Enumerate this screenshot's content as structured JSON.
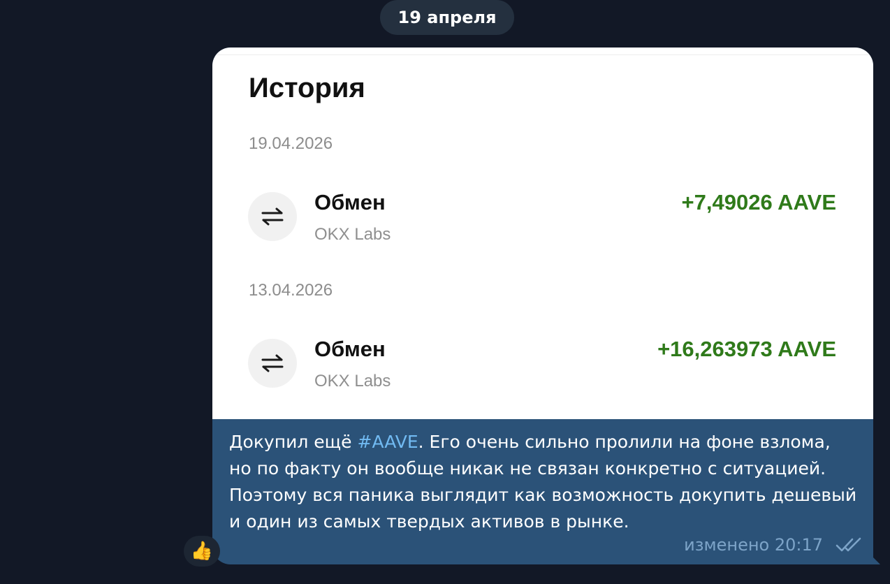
{
  "chat": {
    "date_separator": "19 апреля"
  },
  "message": {
    "screenshot": {
      "title": "История",
      "transactions": [
        {
          "date": "19.04.2026",
          "icon": "swap-arrows-icon",
          "title": "Обмен",
          "subtitle": "OKX Labs",
          "amount": "+7,49026 AAVE"
        },
        {
          "date": "13.04.2026",
          "icon": "swap-arrows-icon",
          "title": "Обмен",
          "subtitle": "OKX Labs",
          "amount": "+16,263973 AAVE"
        }
      ]
    },
    "text": {
      "before_hashtag": "Докупил ещё ",
      "hashtag": "#AAVE",
      "after_hashtag": ". Его очень сильно пролили на фоне взлома, но по факту он вообще никак не связан конкретно с ситуацией. Поэтому вся паника выглядит как возможность докупить дешевый и один из самых твердых активов в рынке."
    },
    "meta": {
      "edited_time": "изменено 20:17",
      "status_icon": "double-check-icon"
    },
    "reaction": {
      "emoji": "👍",
      "icon": "thumbs-up-icon"
    }
  },
  "colors": {
    "background": "#121826",
    "bubble": "#2b5278",
    "hashtag": "#71baf2",
    "amount_positive": "#2f7a1a",
    "meta_text": "#7da4c8"
  }
}
